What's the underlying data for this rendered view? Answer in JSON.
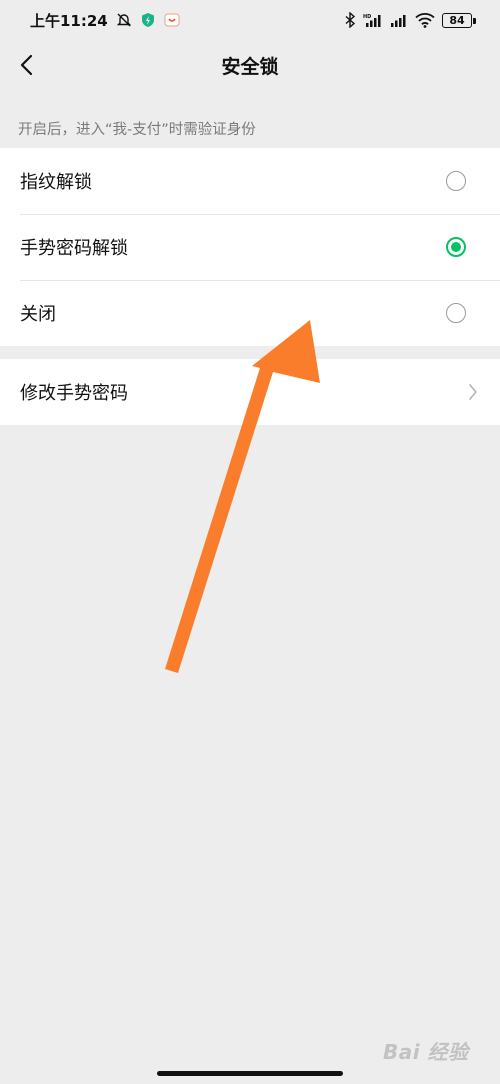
{
  "status_bar": {
    "time": "上午11:24",
    "battery": "84",
    "icons": [
      "bell-muted-icon",
      "shield-icon",
      "app-notification-icon",
      "bluetooth-icon",
      "signal-icon",
      "signal-icon",
      "wifi-icon",
      "battery-icon"
    ]
  },
  "header": {
    "title": "安全锁",
    "back_icon": "chevron-left-icon"
  },
  "hint": "开启后，进入“我-支付”时需验证身份",
  "options": [
    {
      "label": "指纹解锁",
      "selected": false
    },
    {
      "label": "手势密码解锁",
      "selected": true
    },
    {
      "label": "关闭",
      "selected": false
    }
  ],
  "secondary": {
    "label": "修改手势密码",
    "icon": "chevron-right-icon"
  },
  "watermark": "Bai 经验",
  "colors": {
    "accent": "#07c160",
    "annotation_arrow": "#f97d2b",
    "background": "#ededed"
  }
}
